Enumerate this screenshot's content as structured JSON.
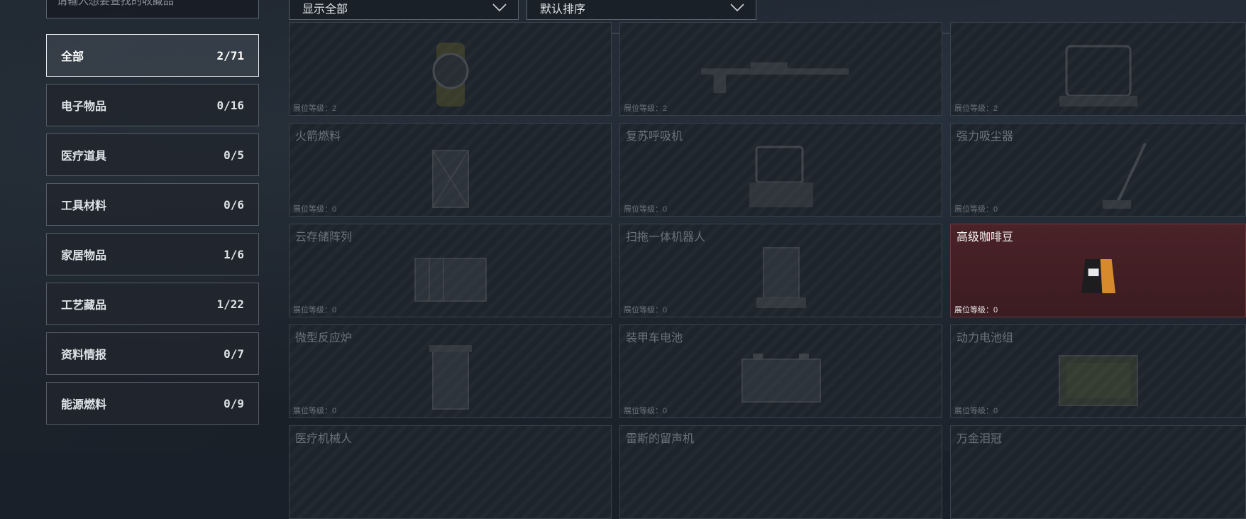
{
  "search": {
    "placeholder": "请输入想要查找的收藏品"
  },
  "categories": [
    {
      "label": "全部",
      "count": "2/71"
    },
    {
      "label": "电子物品",
      "count": "0/16"
    },
    {
      "label": "医疗道具",
      "count": "0/5"
    },
    {
      "label": "工具材料",
      "count": "0/6"
    },
    {
      "label": "家居物品",
      "count": "1/6"
    },
    {
      "label": "工艺藏品",
      "count": "1/22"
    },
    {
      "label": "资料情报",
      "count": "0/7"
    },
    {
      "label": "能源燃料",
      "count": "0/9"
    }
  ],
  "filters": {
    "display": "显示全部",
    "sort": "默认排序"
  },
  "level_label": "展位等级：",
  "items": [
    {
      "name": "",
      "level": "2"
    },
    {
      "name": "",
      "level": "2"
    },
    {
      "name": "",
      "level": "2"
    },
    {
      "name": "火箭燃料",
      "level": "0"
    },
    {
      "name": "复苏呼吸机",
      "level": "0"
    },
    {
      "name": "强力吸尘器",
      "level": "0"
    },
    {
      "name": "云存储阵列",
      "level": "0"
    },
    {
      "name": "扫拖一体机器人",
      "level": "0"
    },
    {
      "name": "高级咖啡豆",
      "level": "0",
      "owned": true
    },
    {
      "name": "微型反应炉",
      "level": "0"
    },
    {
      "name": "装甲车电池",
      "level": "0"
    },
    {
      "name": "动力电池组",
      "level": "0"
    },
    {
      "name": "医疗机械人",
      "level": ""
    },
    {
      "name": "雷斯的留声机",
      "level": ""
    },
    {
      "name": "万金泪冠",
      "level": ""
    }
  ]
}
